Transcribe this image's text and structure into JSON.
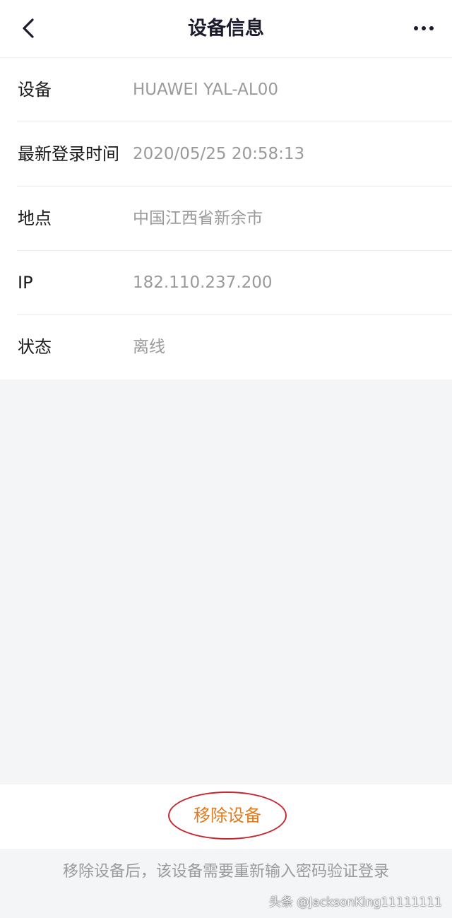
{
  "header": {
    "title": "设备信息",
    "back_icon": "chevron-left-icon",
    "more_icon": "more-horizontal-icon"
  },
  "info": [
    {
      "label": "设备",
      "value": "HUAWEI YAL-AL00"
    },
    {
      "label": "最新登录时间",
      "value": "2020/05/25 20:58:13"
    },
    {
      "label": "地点",
      "value": "中国江西省新余市"
    },
    {
      "label": "IP",
      "value": "182.110.237.200"
    },
    {
      "label": "状态",
      "value": "离线"
    }
  ],
  "actions": {
    "remove_label": "移除设备"
  },
  "footer": {
    "note": "移除设备后，该设备需要重新输入密码验证登录"
  },
  "watermark": {
    "text": "头条 @JacksonKing11111111"
  },
  "colors": {
    "accent_orange": "#e07a1e",
    "annotation_red": "#c8262e",
    "value_gray": "#9a9a9a",
    "background": "#f4f5f7"
  }
}
